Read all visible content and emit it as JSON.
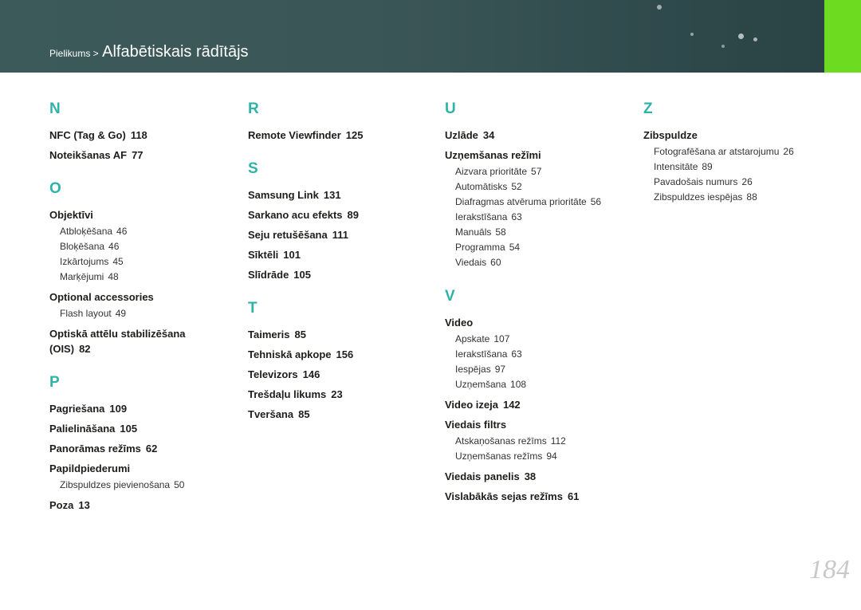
{
  "header": {
    "breadcrumb_parent": "Pielikums >",
    "title": "Alfabētiskais rādītājs"
  },
  "page_number": "184",
  "columns": [
    {
      "sections": [
        {
          "letter": "N",
          "entries": [
            {
              "label": "NFC (Tag & Go)",
              "page": "118"
            },
            {
              "label": "Noteikšanas AF",
              "page": "77"
            }
          ]
        },
        {
          "letter": "O",
          "entries": [
            {
              "label": "Objektīvi",
              "page": "",
              "subs": [
                {
                  "label": "Atbloķēšana",
                  "page": "46"
                },
                {
                  "label": "Bloķēšana",
                  "page": "46"
                },
                {
                  "label": "Izkārtojums",
                  "page": "45"
                },
                {
                  "label": "Marķējumi",
                  "page": "48"
                }
              ]
            },
            {
              "label": "Optional accessories",
              "page": "",
              "subs": [
                {
                  "label": "Flash layout",
                  "page": "49"
                }
              ]
            },
            {
              "label": "Optiskā attēlu stabilizēšana (OIS)",
              "page": "82"
            }
          ]
        },
        {
          "letter": "P",
          "entries": [
            {
              "label": "Pagriešana",
              "page": "109"
            },
            {
              "label": "Palielināšana",
              "page": "105"
            },
            {
              "label": "Panorāmas režīms",
              "page": "62"
            },
            {
              "label": "Papildpiederumi",
              "page": "",
              "subs": [
                {
                  "label": "Zibspuldzes pievienošana",
                  "page": "50"
                }
              ]
            },
            {
              "label": "Poza",
              "page": "13"
            }
          ]
        }
      ]
    },
    {
      "sections": [
        {
          "letter": "R",
          "entries": [
            {
              "label": "Remote Viewfinder",
              "page": "125"
            }
          ]
        },
        {
          "letter": "S",
          "entries": [
            {
              "label": "Samsung Link",
              "page": "131"
            },
            {
              "label": "Sarkano acu efekts",
              "page": "89"
            },
            {
              "label": "Seju retušēšana",
              "page": "111"
            },
            {
              "label": "Sīktēli",
              "page": "101"
            },
            {
              "label": "Slīdrāde",
              "page": "105"
            }
          ]
        },
        {
          "letter": "T",
          "entries": [
            {
              "label": "Taimeris",
              "page": "85"
            },
            {
              "label": "Tehniskā apkope",
              "page": "156"
            },
            {
              "label": "Televizors",
              "page": "146"
            },
            {
              "label": "Trešdaļu likums",
              "page": "23"
            },
            {
              "label": "Tveršana",
              "page": "85"
            }
          ]
        }
      ]
    },
    {
      "sections": [
        {
          "letter": "U",
          "entries": [
            {
              "label": "Uzlāde",
              "page": "34"
            },
            {
              "label": "Uzņemšanas režīmi",
              "page": "",
              "subs": [
                {
                  "label": "Aizvara prioritāte",
                  "page": "57"
                },
                {
                  "label": "Automātisks",
                  "page": "52"
                },
                {
                  "label": "Diafragmas atvēruma prioritāte",
                  "page": "56"
                },
                {
                  "label": "Ierakstīšana",
                  "page": "63"
                },
                {
                  "label": "Manuāls",
                  "page": "58"
                },
                {
                  "label": "Programma",
                  "page": "54"
                },
                {
                  "label": "Viedais",
                  "page": "60"
                }
              ]
            }
          ]
        },
        {
          "letter": "V",
          "entries": [
            {
              "label": "Video",
              "page": "",
              "subs": [
                {
                  "label": "Apskate",
                  "page": "107"
                },
                {
                  "label": "Ierakstīšana",
                  "page": "63"
                },
                {
                  "label": "Iespējas",
                  "page": "97"
                },
                {
                  "label": "Uzņemšana",
                  "page": "108"
                }
              ]
            },
            {
              "label": "Video izeja",
              "page": "142"
            },
            {
              "label": "Viedais filtrs",
              "page": "",
              "subs": [
                {
                  "label": "Atskaņošanas režīms",
                  "page": "112"
                },
                {
                  "label": "Uzņemšanas režīms",
                  "page": "94"
                }
              ]
            },
            {
              "label": "Viedais panelis",
              "page": "38"
            },
            {
              "label": "Vislabākās sejas režīms",
              "page": "61"
            }
          ]
        }
      ]
    },
    {
      "sections": [
        {
          "letter": "Z",
          "entries": [
            {
              "label": "Zibspuldze",
              "page": "",
              "subs": [
                {
                  "label": "Fotografēšana ar atstarojumu",
                  "page": "26"
                },
                {
                  "label": "Intensitāte",
                  "page": "89"
                },
                {
                  "label": "Pavadošais numurs",
                  "page": "26"
                },
                {
                  "label": "Zibspuldzes iespējas",
                  "page": "88"
                }
              ]
            }
          ]
        }
      ]
    }
  ]
}
